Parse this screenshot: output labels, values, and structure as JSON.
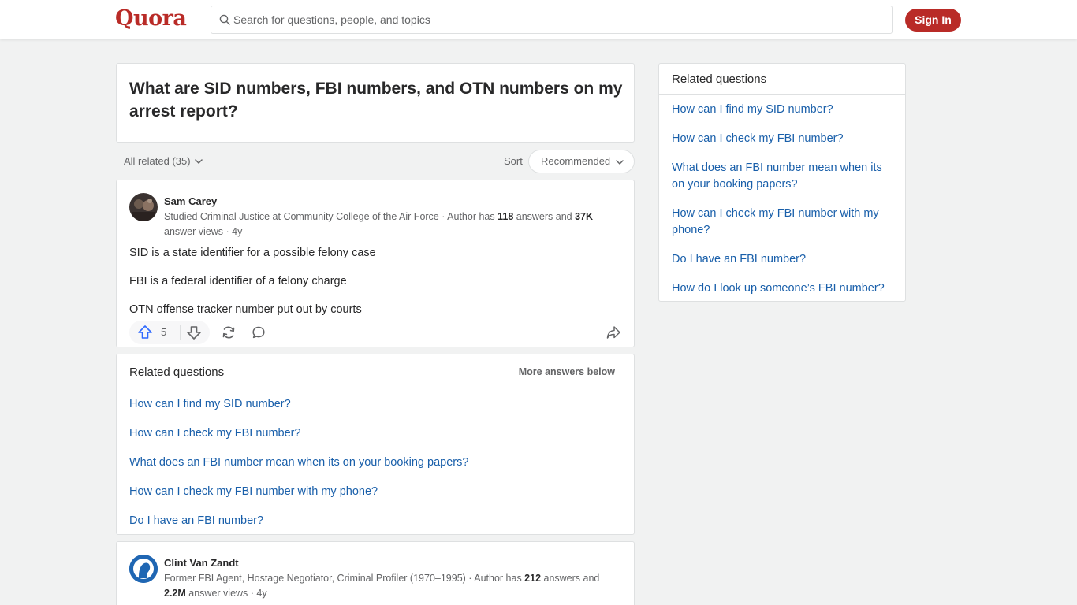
{
  "header": {
    "logo": "Quora",
    "search_placeholder": "Search for questions, people, and topics",
    "signin_label": "Sign In"
  },
  "question": {
    "title": "What are SID numbers, FBI numbers, and OTN numbers on my arrest report?"
  },
  "filter": {
    "all_related": "All related (35)",
    "sort_label": "Sort",
    "sort_value": "Recommended"
  },
  "answer1": {
    "author": "Sam Carey",
    "cred_prefix": "Studied Criminal Justice at Community College of the Air Force · Author has ",
    "answers_count": "118",
    "cred_mid": " answers and ",
    "views_count": "37K",
    "cred_suffix": " answer views · 4y",
    "paragraphs": [
      "SID is a state identifier for a possible felony case",
      "FBI is a federal identifier of a felony charge",
      "OTN offense tracker number put out by courts"
    ],
    "upvotes": "5"
  },
  "related_inline": {
    "title": "Related questions",
    "more": "More answers below",
    "items": [
      "How can I find my SID number?",
      "How can I check my FBI number?",
      "What does an FBI number mean when its on your booking papers?",
      "How can I check my FBI number with my phone?",
      "Do I have an FBI number?"
    ]
  },
  "answer2": {
    "author": "Clint Van Zandt",
    "cred_prefix": "Former FBI Agent, Hostage Negotiator, Criminal Profiler (1970–1995) · Author has ",
    "answers_count": "212",
    "cred_mid": " answers and ",
    "views_count": "2.2M",
    "cred_suffix": " answer views · 4y"
  },
  "sidebar": {
    "title": "Related questions",
    "items": [
      "How can I find my SID number?",
      "How can I check my FBI number?",
      "What does an FBI number mean when its on your booking papers?",
      "How can I check my FBI number with my phone?",
      "Do I have an FBI number?",
      "How do I look up someone’s FBI number?"
    ]
  },
  "colors": {
    "brand": "#b92b27",
    "link": "#195faa",
    "upvote": "#2e69ff"
  }
}
